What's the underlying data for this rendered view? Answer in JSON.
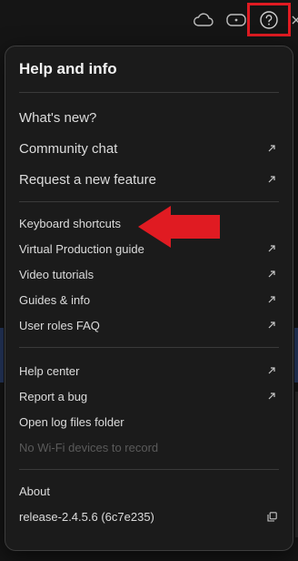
{
  "toolbar": {
    "icons": [
      "cloud-icon",
      "vr-headset-icon",
      "help-icon",
      "close-icon"
    ]
  },
  "popover": {
    "title": "Help and info",
    "section1": [
      {
        "label": "What's new?",
        "external": false
      },
      {
        "label": "Community chat",
        "external": true
      },
      {
        "label": "Request a new feature",
        "external": true
      }
    ],
    "section2": [
      {
        "label": "Keyboard shortcuts",
        "external": false
      },
      {
        "label": "Virtual Production guide",
        "external": true
      },
      {
        "label": "Video tutorials",
        "external": true
      },
      {
        "label": "Guides & info",
        "external": true
      },
      {
        "label": "User roles FAQ",
        "external": true
      }
    ],
    "section3": [
      {
        "label": "Help center",
        "external": true
      },
      {
        "label": "Report a bug",
        "external": true
      },
      {
        "label": "Open log files folder",
        "external": false
      },
      {
        "label": "No Wi-Fi devices to record",
        "disabled": true
      }
    ],
    "section4": {
      "about_label": "About",
      "version": "release-2.4.5.6 (6c7e235)"
    }
  },
  "colors": {
    "highlight": "#e01b22",
    "popover_bg": "#1b1b1b",
    "text": "#dcdcdc",
    "disabled_text": "#5a5a5a"
  }
}
